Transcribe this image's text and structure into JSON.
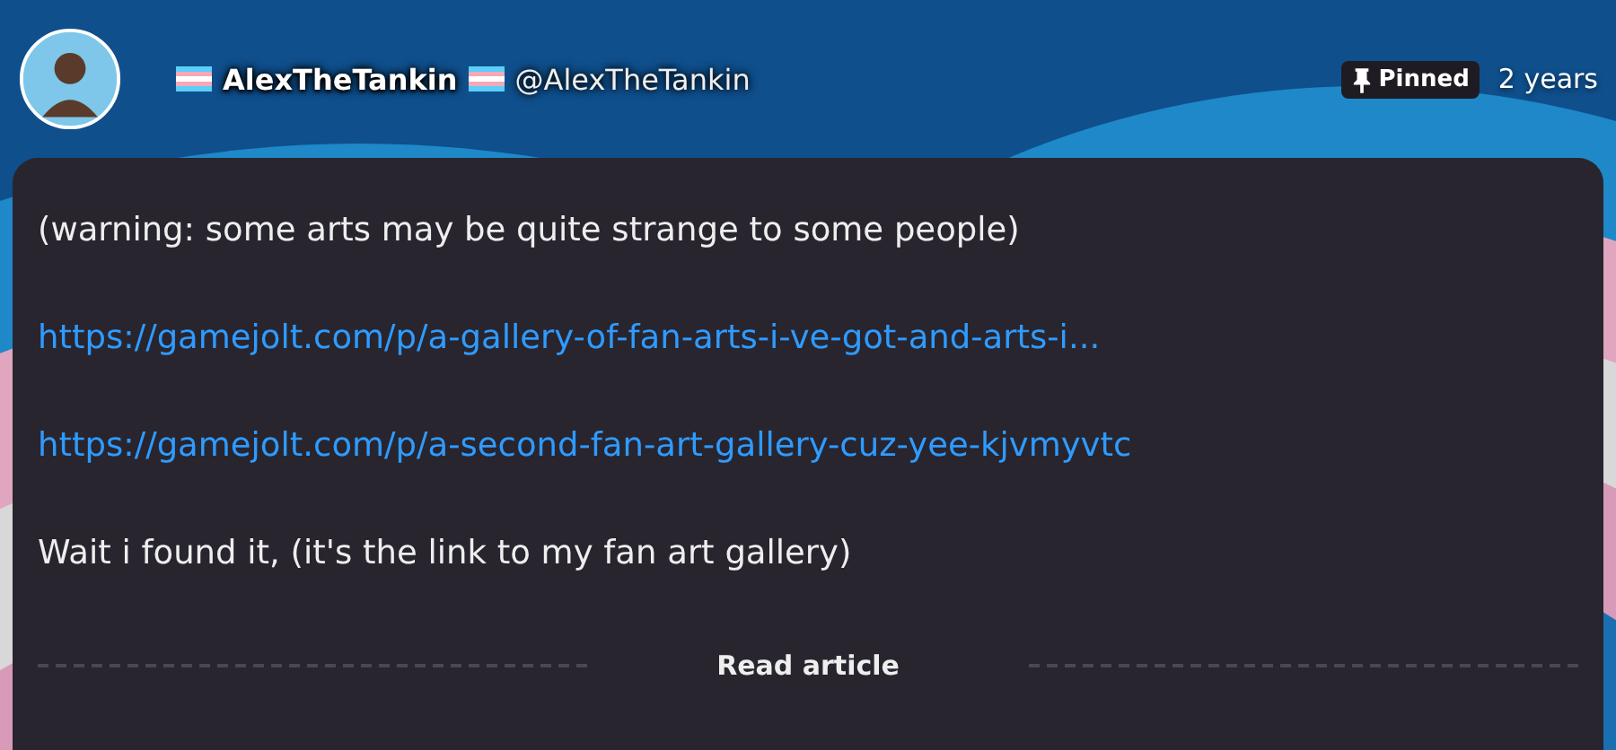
{
  "author": {
    "display_name": "AlexTheTankin",
    "username": "@AlexTheTankin"
  },
  "pinned": {
    "label": "Pinned"
  },
  "time": "2 years",
  "post": {
    "paragraphs": [
      {
        "kind": "text",
        "text": "(warning: some arts may be quite strange to some people)"
      },
      {
        "kind": "link",
        "text": "https://gamejolt.com/p/a-gallery-of-fan-arts-i-ve-got-and-arts-i..."
      },
      {
        "kind": "link",
        "text": "https://gamejolt.com/p/a-second-fan-art-gallery-cuz-yee-kjvmyvtc"
      },
      {
        "kind": "text",
        "text": "Wait i found it, (it's the link to my fan art gallery)"
      }
    ]
  },
  "read_more": "Read article"
}
